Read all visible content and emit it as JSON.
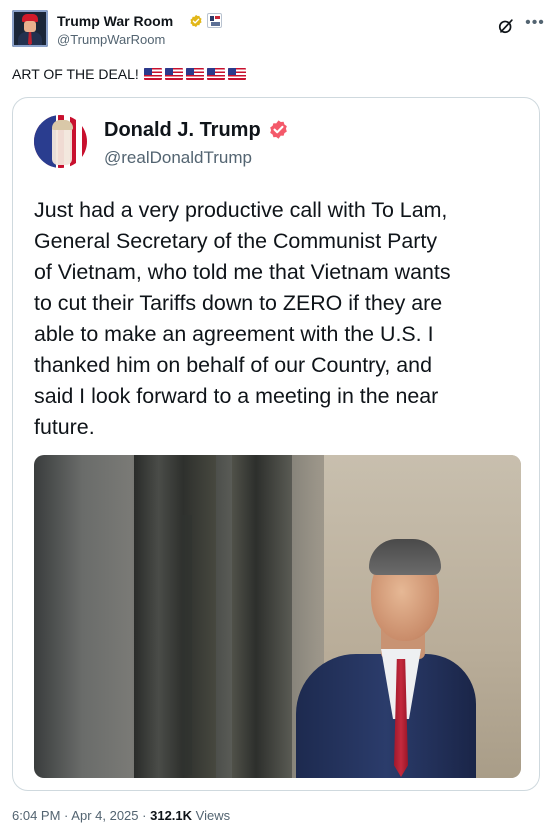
{
  "author": {
    "display_name": "Trump War Room",
    "handle": "@TrumpWarRoom",
    "verified": "gold"
  },
  "post": {
    "text": "ART OF THE DEAL!",
    "emoji": [
      "us-flag-emoji",
      "us-flag-emoji",
      "us-flag-emoji",
      "us-flag-emoji",
      "us-flag-emoji"
    ]
  },
  "quoted": {
    "display_name": "Donald J. Trump",
    "handle": "@realDonaldTrump",
    "verified": "red",
    "body_lines": [
      "Just had a very productive call with To Lam,",
      "General Secretary of the Communist Party",
      "of Vietnam, who told me that Vietnam wants",
      "to cut their Tariffs down to ZERO if they are",
      "able to make an agreement with the U.S. I",
      "thanked him on behalf of our Country, and",
      "said I look forward to a meeting in the near",
      "future."
    ]
  },
  "meta": {
    "time": "6:04 PM",
    "separator": "·",
    "date": "Apr 4, 2025",
    "views_count": "312.1K",
    "views_label": "Views"
  },
  "colors": {
    "text_primary": "#0f1419",
    "text_secondary": "#536471",
    "border": "#cfd9de",
    "verified_gold": "#e2b719",
    "verified_red": "#f4596a"
  }
}
